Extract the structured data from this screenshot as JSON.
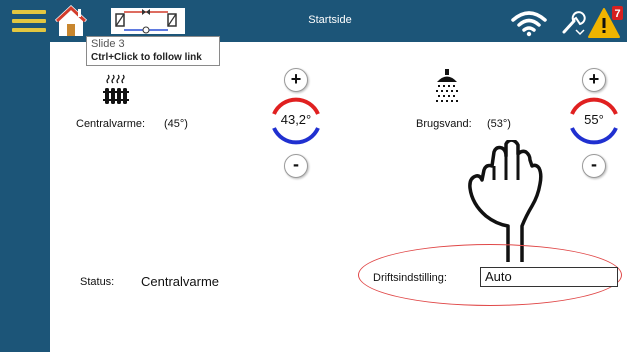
{
  "header": {
    "title": "Startside",
    "colors": {
      "bar": "#1c5578",
      "menu": "#e2c640",
      "warning": "#f0b400",
      "badge": "#d62020"
    },
    "warning_count": "7"
  },
  "tooltip": {
    "slide": "Slide 3",
    "hint": "Ctrl+Click to follow link"
  },
  "heating": {
    "label": "Centralvarme:",
    "setpoint": "(45°)",
    "value": "43,2°",
    "plus": "+",
    "minus": "-"
  },
  "hotwater": {
    "label": "Brugsvand:",
    "setpoint": "(53°)",
    "value": "55°",
    "plus": "+",
    "minus": "-"
  },
  "status": {
    "label": "Status:",
    "value": "Centralvarme"
  },
  "mode": {
    "label": "Driftsindstilling:",
    "value": "Auto"
  },
  "icons": [
    "menu-icon",
    "home-icon",
    "system-schema-icon",
    "wifi-icon",
    "wrench-icon",
    "warning-icon",
    "radiator-icon",
    "shower-icon",
    "pointing-hand-icon"
  ]
}
